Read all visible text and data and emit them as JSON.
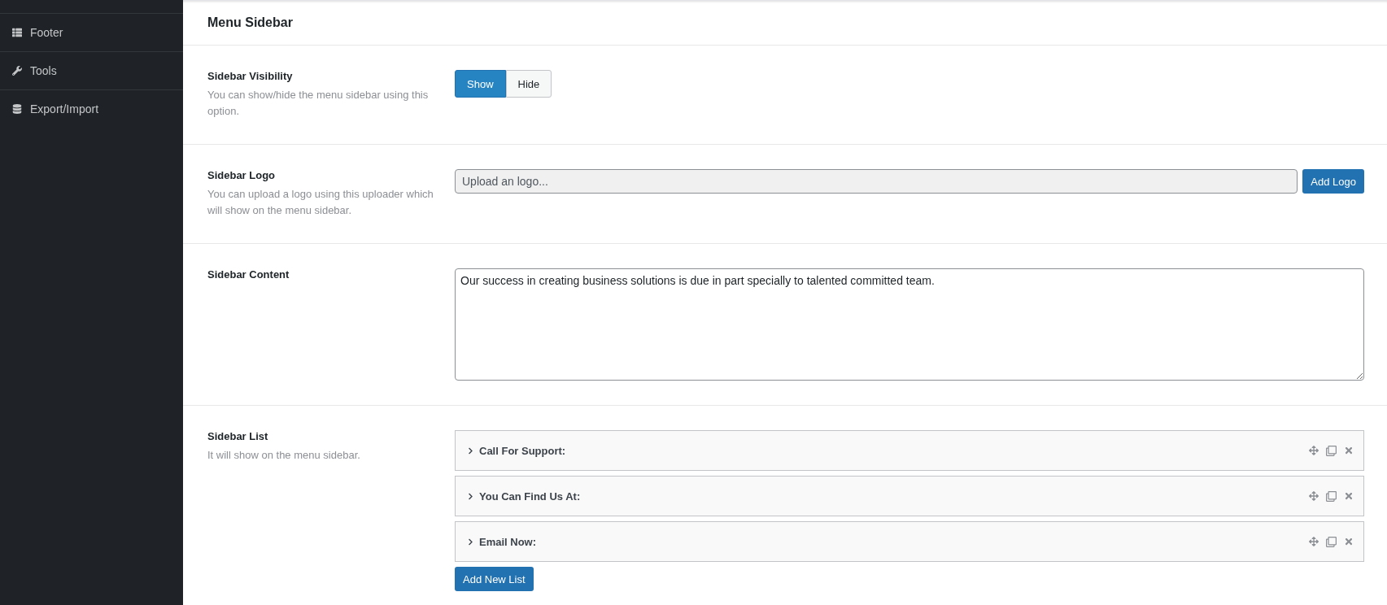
{
  "sidebar": {
    "items": [
      {
        "kind": "footer",
        "label": "Footer",
        "selected": false
      },
      {
        "kind": "tools",
        "label": "Tools",
        "selected": false
      },
      {
        "kind": "export",
        "label": "Export/Import",
        "selected": false
      }
    ]
  },
  "panel": {
    "title": "Menu Sidebar",
    "visibility": {
      "label": "Sidebar Visibility",
      "description": "You can show/hide the menu sidebar using this option.",
      "options": [
        {
          "label": "Show",
          "selected": true
        },
        {
          "label": "Hide",
          "selected": false
        }
      ]
    },
    "logo": {
      "label": "Sidebar Logo",
      "description": "You can upload a logo using this uploader which will show on the menu sidebar.",
      "placeholder": "Upload an logo...",
      "button": "Add Logo"
    },
    "content": {
      "label": "Sidebar Content",
      "value": "Our success in creating business solutions is due in part specially to talented committed team."
    },
    "list": {
      "label": "Sidebar List",
      "description": "It will show on the menu sidebar.",
      "items": [
        {
          "title": "Call For Support:",
          "expanded": false
        },
        {
          "title": "You Can Find Us At:",
          "expanded": false
        },
        {
          "title": "Email Now:",
          "expanded": false
        }
      ],
      "button": "Add New List"
    }
  }
}
